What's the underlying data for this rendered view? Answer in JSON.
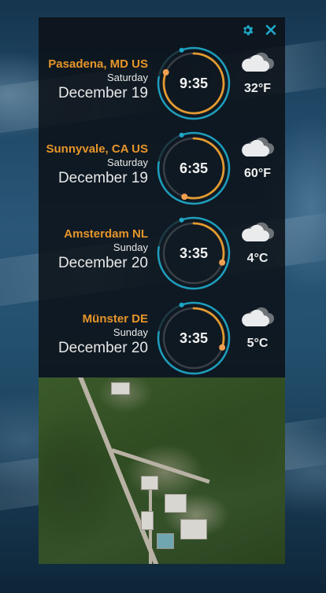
{
  "toolbar": {
    "settings_icon": "gear-icon",
    "close_icon": "close-icon",
    "accent_color": "#1fa8c9"
  },
  "clocks": [
    {
      "city": "Pasadena, MD US",
      "weekday": "Saturday",
      "date": "December 19",
      "time": "9:35",
      "temperature": "32°F",
      "weather_icon": "cloudy-icon",
      "ring_fraction": 0.81
    },
    {
      "city": "Sunnyvale, CA US",
      "weekday": "Saturday",
      "date": "December 19",
      "time": "6:35",
      "temperature": "60°F",
      "weather_icon": "cloudy-icon",
      "ring_fraction": 0.55
    },
    {
      "city": "Amsterdam NL",
      "weekday": "Sunday",
      "date": "December 20",
      "time": "3:35",
      "temperature": "4°C",
      "weather_icon": "cloudy-icon",
      "ring_fraction": 0.3
    },
    {
      "city": "Münster DE",
      "weekday": "Sunday",
      "date": "December 20",
      "time": "3:35",
      "temperature": "5°C",
      "weather_icon": "cloudy-icon",
      "ring_fraction": 0.3
    }
  ],
  "colors": {
    "city": "#e6952a",
    "ring_progress": "#e39a30",
    "ring_track": "#3a3f45",
    "ring_outer_glow": "#1fa8c9"
  }
}
